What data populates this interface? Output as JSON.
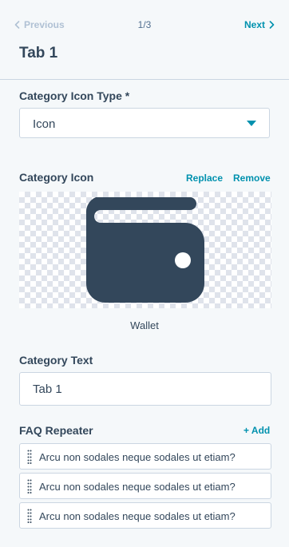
{
  "nav": {
    "previous_label": "Previous",
    "counter": "1/3",
    "next_label": "Next"
  },
  "header": {
    "title": "Tab 1"
  },
  "icon_type": {
    "label": "Category Icon Type *",
    "value": "Icon"
  },
  "category_icon": {
    "label": "Category Icon",
    "replace_label": "Replace",
    "remove_label": "Remove",
    "icon_name": "wallet-icon",
    "caption": "Wallet",
    "icon_color": "#33475b"
  },
  "category_text": {
    "label": "Category Text",
    "value": "Tab 1"
  },
  "faq": {
    "label": "FAQ Repeater",
    "add_label": "+ Add",
    "items": [
      {
        "text": "Arcu non sodales neque sodales ut etiam?"
      },
      {
        "text": "Arcu non sodales neque sodales ut etiam?"
      },
      {
        "text": "Arcu non sodales neque sodales ut etiam?"
      }
    ]
  },
  "colors": {
    "link": "#0091ae",
    "text": "#33475b",
    "border": "#cbd6e2",
    "background": "#f5f8fa"
  }
}
